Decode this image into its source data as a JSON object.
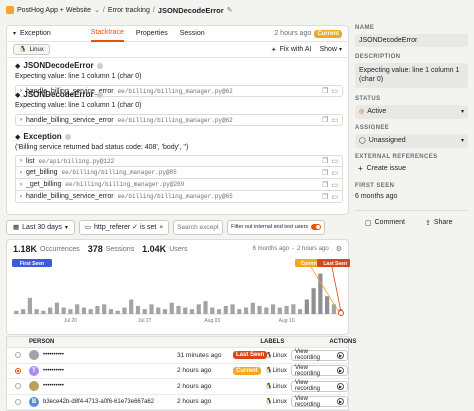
{
  "breadcrumb": {
    "project": "PostHog App + Website",
    "section": "Error tracking",
    "issue": "JSONDecodeError"
  },
  "exception_panel": {
    "title": "Exception",
    "tabs": [
      "Stacktrace",
      "Properties",
      "Session"
    ],
    "time": "2 hours ago",
    "current_badge": "Current",
    "os": "Linux",
    "fix_ai": "Fix with AI",
    "show": "Show",
    "blocks": [
      {
        "type": "JSONDecodeError",
        "message": "Expecting value: line 1 column 1 (char 0)",
        "frames": [
          {
            "fn": "handle_billing_service_error",
            "file": "ee/billing/billing_manager.py@62"
          }
        ]
      },
      {
        "type": "JSONDecodeError",
        "message": "Expecting value: line 1 column 1 (char 0)",
        "frames": [
          {
            "fn": "handle_billing_service_error",
            "file": "ee/billing/billing_manager.py@62"
          }
        ]
      },
      {
        "type": "Exception",
        "message": "('Billing service returned bad status code: 408', 'body', '')",
        "frames": [
          {
            "fn": "list",
            "file": "ee/api/billing.py@122"
          },
          {
            "fn": "get_billing",
            "file": "ee/billing/billing_manager.py@85"
          },
          {
            "fn": "_get_billing",
            "file": "ee/billing/billing_manager.py@269"
          },
          {
            "fn": "handle_billing_service_error",
            "file": "ee/billing/billing_manager.py@65"
          }
        ]
      }
    ]
  },
  "filters": {
    "date": "Last 30 days",
    "property": "http_referer ✓ is set",
    "search_placeholder": "Search exceptions",
    "filter_internal": "Filter out internal and test users"
  },
  "stats": {
    "occurrences_num": "1.18K",
    "occurrences_label": "Occurrences",
    "sessions_num": "378",
    "sessions_label": "Sessions",
    "users_num": "1.04K",
    "users_label": "Users",
    "time": "6 months ago",
    "sep": "-",
    "time2": "2 hours ago"
  },
  "chart_data": {
    "type": "bar",
    "x_ticks": [
      "Jul 20",
      "Jul 27",
      "Aug 03",
      "Aug 10"
    ],
    "values": [
      2,
      3,
      10,
      3,
      2,
      4,
      7,
      4,
      3,
      6,
      4,
      3,
      5,
      6,
      3,
      2,
      4,
      9,
      5,
      3,
      6,
      4,
      3,
      7,
      5,
      4,
      3,
      6,
      8,
      4,
      3,
      5,
      6,
      3,
      4,
      7,
      5,
      4,
      6,
      4,
      5,
      6,
      3,
      9,
      16,
      25,
      11,
      6,
      3
    ],
    "ymax": 26,
    "markers": {
      "first_seen": "First Seen",
      "current": "Current",
      "last_seen": "Last Seen"
    }
  },
  "table": {
    "headers": [
      "PERSON",
      "",
      "LABELS",
      "ACTIONS"
    ],
    "rows": [
      {
        "initial": "",
        "person": "••••••••••",
        "time": "31 minutes ago",
        "badge": "Last Seen",
        "os": "Linux",
        "action": "View recording",
        "avatar_color": "#9ea3ac",
        "checked": false
      },
      {
        "initial": "T",
        "person": "••••••••••",
        "time": "2 hours ago",
        "badge": "Current",
        "os": "Linux",
        "action": "View recording",
        "avatar_color": "#a78bfa",
        "checked": true
      },
      {
        "initial": "",
        "person": "••••••••••",
        "time": "2 hours ago",
        "badge": "",
        "os": "Linux",
        "action": "View recording",
        "avatar_color": "#b9a15b",
        "checked": false
      },
      {
        "initial": "B",
        "person": "b3ece42b-d8f4-4713-a0f6-61e73e667a62",
        "time": "2 hours ago",
        "badge": "",
        "os": "Linux",
        "action": "View recording",
        "avatar_color": "#5a8dd6",
        "checked": false
      }
    ]
  },
  "sidebar": {
    "name_label": "NAME",
    "name_value": "JSONDecodeError",
    "desc_label": "DESCRIPTION",
    "desc_value": "Expecting value: line 1 column 1 (char 0)",
    "status_label": "STATUS",
    "status_value": "Active",
    "assignee_label": "ASSIGNEE",
    "assignee_value": "Unassigned",
    "ext_label": "EXTERNAL REFERENCES",
    "create_issue": "Create issue",
    "first_seen_label": "FIRST SEEN",
    "first_seen_value": "6 months ago",
    "comment": "Comment",
    "share": "Share"
  },
  "colors": {
    "accent": "#f54e00",
    "current": "#f5a623",
    "last_seen": "#d9461a",
    "first_seen": "#3b5bdb",
    "active": "#d9461a"
  }
}
